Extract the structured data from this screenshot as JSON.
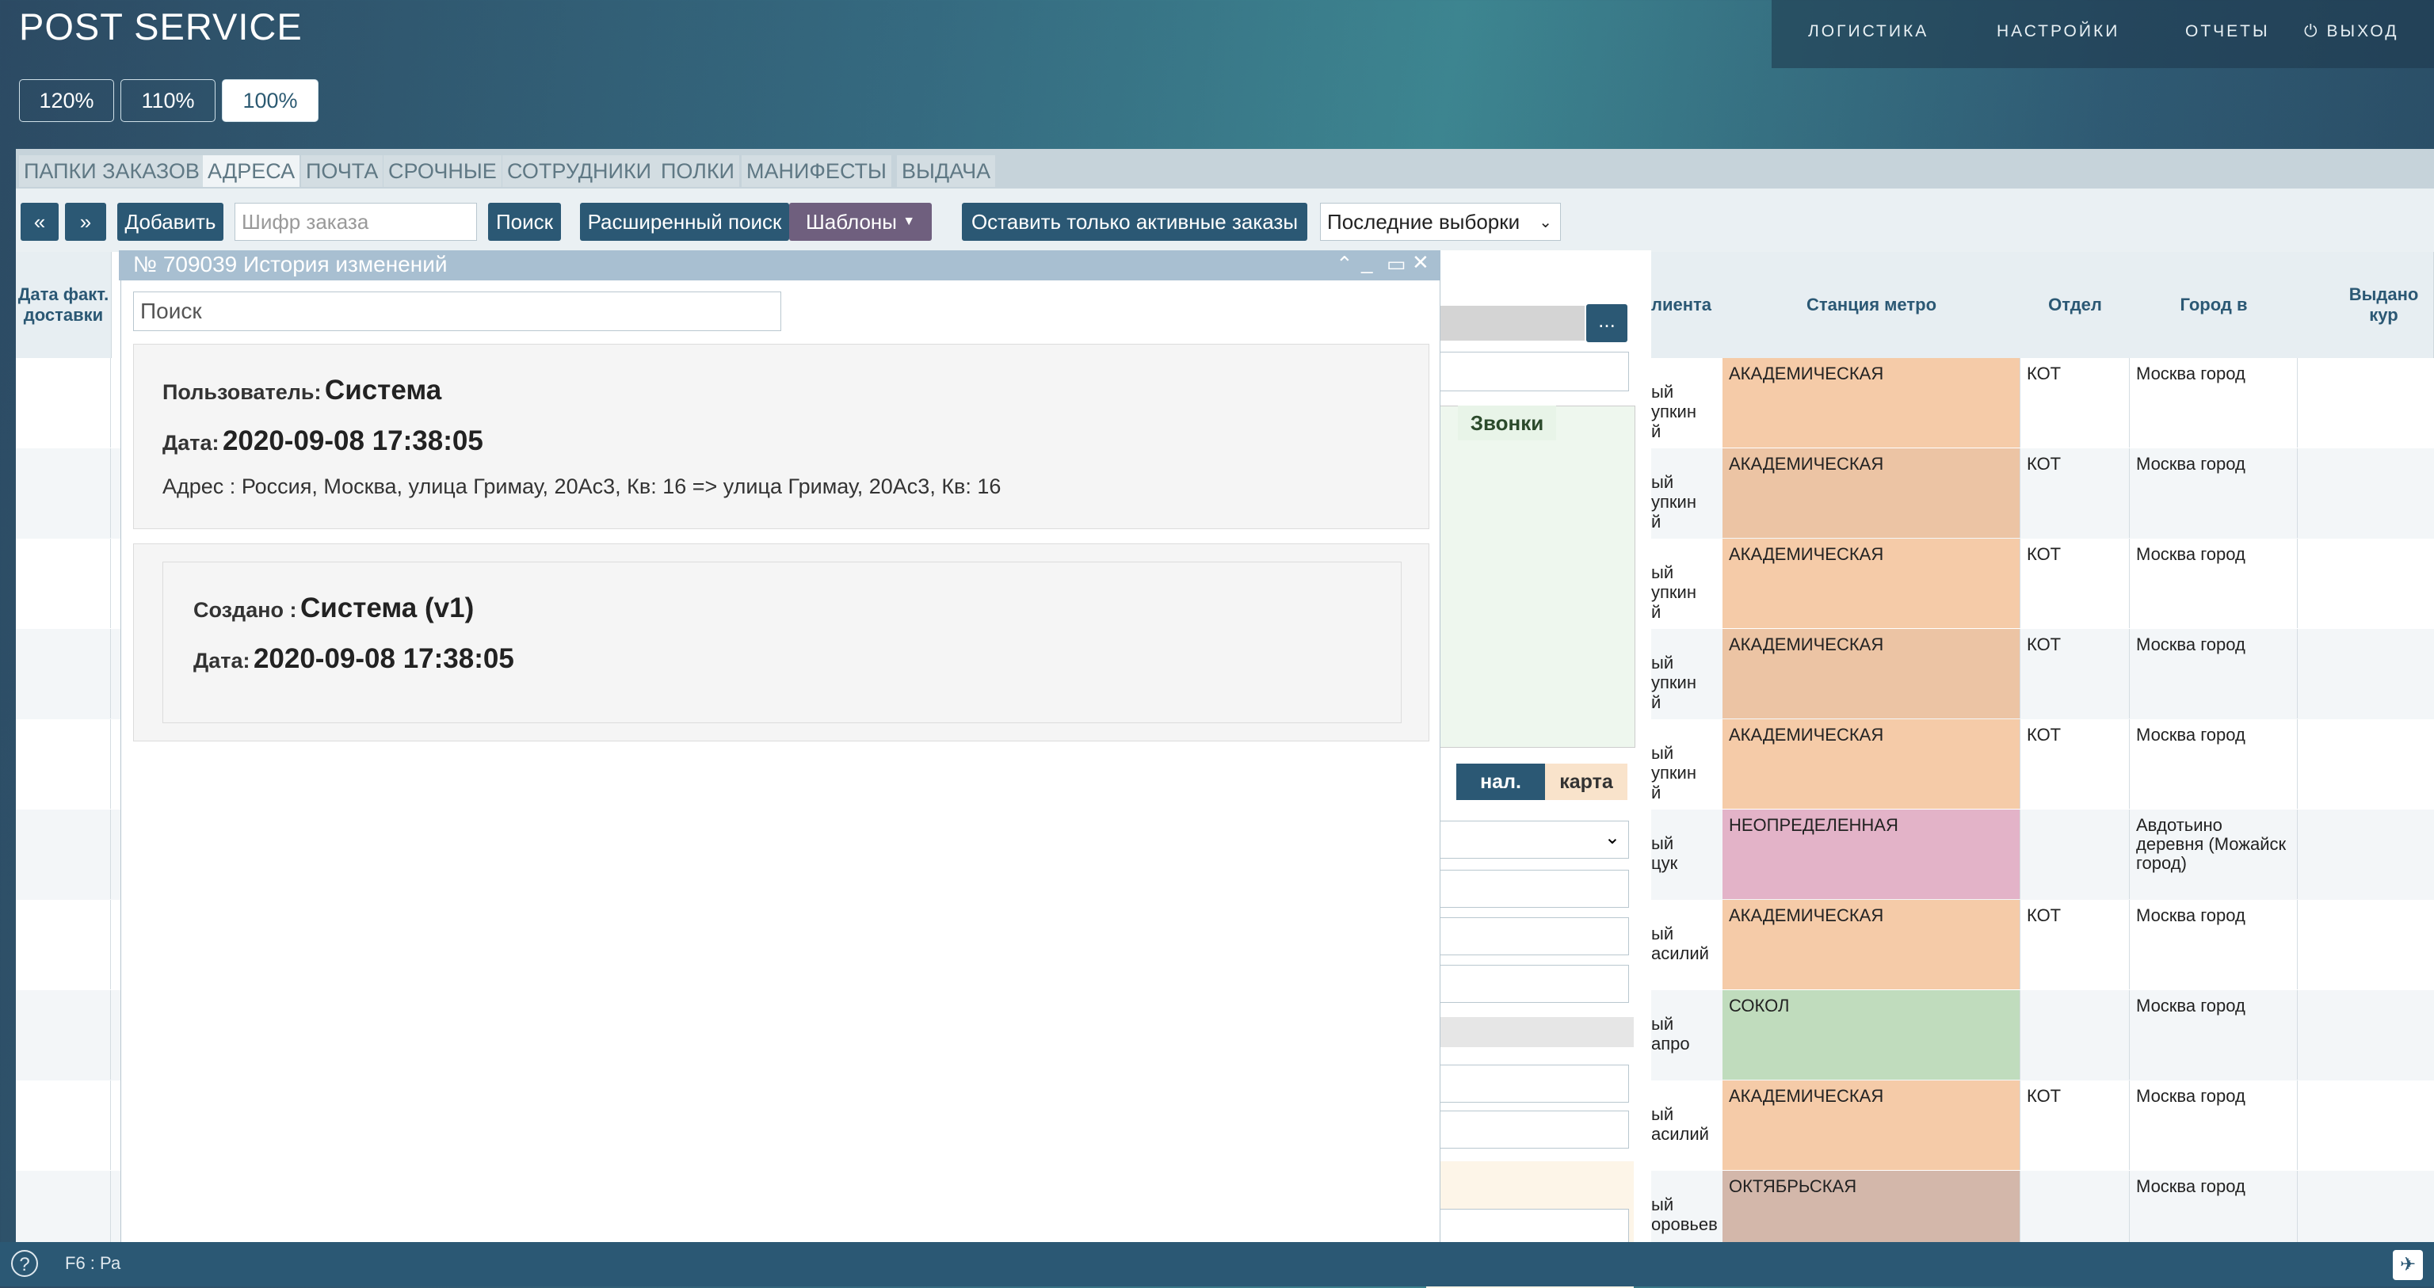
{
  "app": {
    "title": "POST SERVICE"
  },
  "top_menu": {
    "logistics": "ЛОГИСТИКА",
    "settings": "НАСТРОЙКИ",
    "reports": "ОТЧЕТЫ",
    "logout": "ВЫХОД"
  },
  "zoom": {
    "z120": "120%",
    "z110": "110%",
    "z100": "100%",
    "selected": "100%"
  },
  "tabs": [
    "ПАПКИ ЗАКАЗОВ",
    "АДРЕСА",
    "ПОЧТА",
    "СРОЧНЫЕ",
    "СОТРУДНИКИ",
    "ПОЛКИ",
    "МАНИФЕСТЫ",
    "ВЫДАЧА"
  ],
  "toolbar": {
    "prev": "«",
    "next": "»",
    "add": "Добавить",
    "order_placeholder": "Шифр заказа",
    "search": "Поиск",
    "advanced": "Расширенный поиск",
    "templates": "Шаблоны",
    "active_only": "Оставить только активные заказы",
    "recent": "Последние выборки"
  },
  "table": {
    "headers": {
      "delivery_date": "Дата факт. доставки",
      "client": "лиента",
      "metro": "Станция метро",
      "dept": "Отдел",
      "city": "Город в",
      "issued": "Выдано кур"
    },
    "rows": [
      {
        "frag": "ый\nупкин\nй",
        "metro": "АКАДЕМИЧЕСКАЯ",
        "dept": "КОТ",
        "city": "Москва город",
        "color": "#f5cba8"
      },
      {
        "frag": "ый\nупкин\nй",
        "metro": "АКАДЕМИЧЕСКАЯ",
        "dept": "КОТ",
        "city": "Москва город",
        "color": "#ecc4a4"
      },
      {
        "frag": "ый\nупкин\nй",
        "metro": "АКАДЕМИЧЕСКАЯ",
        "dept": "КОТ",
        "city": "Москва город",
        "color": "#f5cba8"
      },
      {
        "frag": "ый\nупкин\nй",
        "metro": "АКАДЕМИЧЕСКАЯ",
        "dept": "КОТ",
        "city": "Москва город",
        "color": "#ecc4a4"
      },
      {
        "frag": "ый\nупкин\nй",
        "metro": "АКАДЕМИЧЕСКАЯ",
        "dept": "КОТ",
        "city": "Москва город",
        "color": "#f5cba8"
      },
      {
        "frag": "ый\nцук",
        "metro": "НЕОПРЕДЕЛЕННАЯ",
        "dept": "",
        "city": "Авдотьино деревня (Можайск город)",
        "color": "#e3b3c8"
      },
      {
        "frag": "ый\nасилий",
        "metro": "АКАДЕМИЧЕСКАЯ",
        "dept": "КОТ",
        "city": "Москва город",
        "color": "#f5cba8"
      },
      {
        "frag": "ый\nапро",
        "metro": "СОКОЛ",
        "dept": "",
        "city": "Москва город",
        "color": "#c0dcbd"
      },
      {
        "frag": "ый\nасилий",
        "metro": "АКАДЕМИЧЕСКАЯ",
        "dept": "КОТ",
        "city": "Москва город",
        "color": "#f5cba8"
      },
      {
        "frag": "ый\nоровьев",
        "metro": "ОКТЯБРЬСКАЯ",
        "dept": "",
        "city": "Москва город",
        "color": "#d3b7aa"
      }
    ]
  },
  "back_modal": {
    "calls_tab": "Звонки",
    "cash": "нал.",
    "card": "карта",
    "more": "..."
  },
  "history": {
    "title": "№ 709039 История изменений",
    "search_placeholder": "Поиск",
    "entry": {
      "user_label": "Пользователь:",
      "user": "Система",
      "date_label": "Дата:",
      "date": "2020-09-08 17:38:05",
      "address_label": "Адрес :",
      "address": "Россия, Москва, улица Гримау, 20Ас3, Кв: 16 => улица Гримау, 20Ас3, Кв: 16"
    },
    "created": {
      "label": "Создано :",
      "by": "Система (v1)",
      "date_label": "Дата:",
      "date": "2020-09-08 17:38:05"
    }
  },
  "status_bar": {
    "hint": "F6 : Ра"
  }
}
